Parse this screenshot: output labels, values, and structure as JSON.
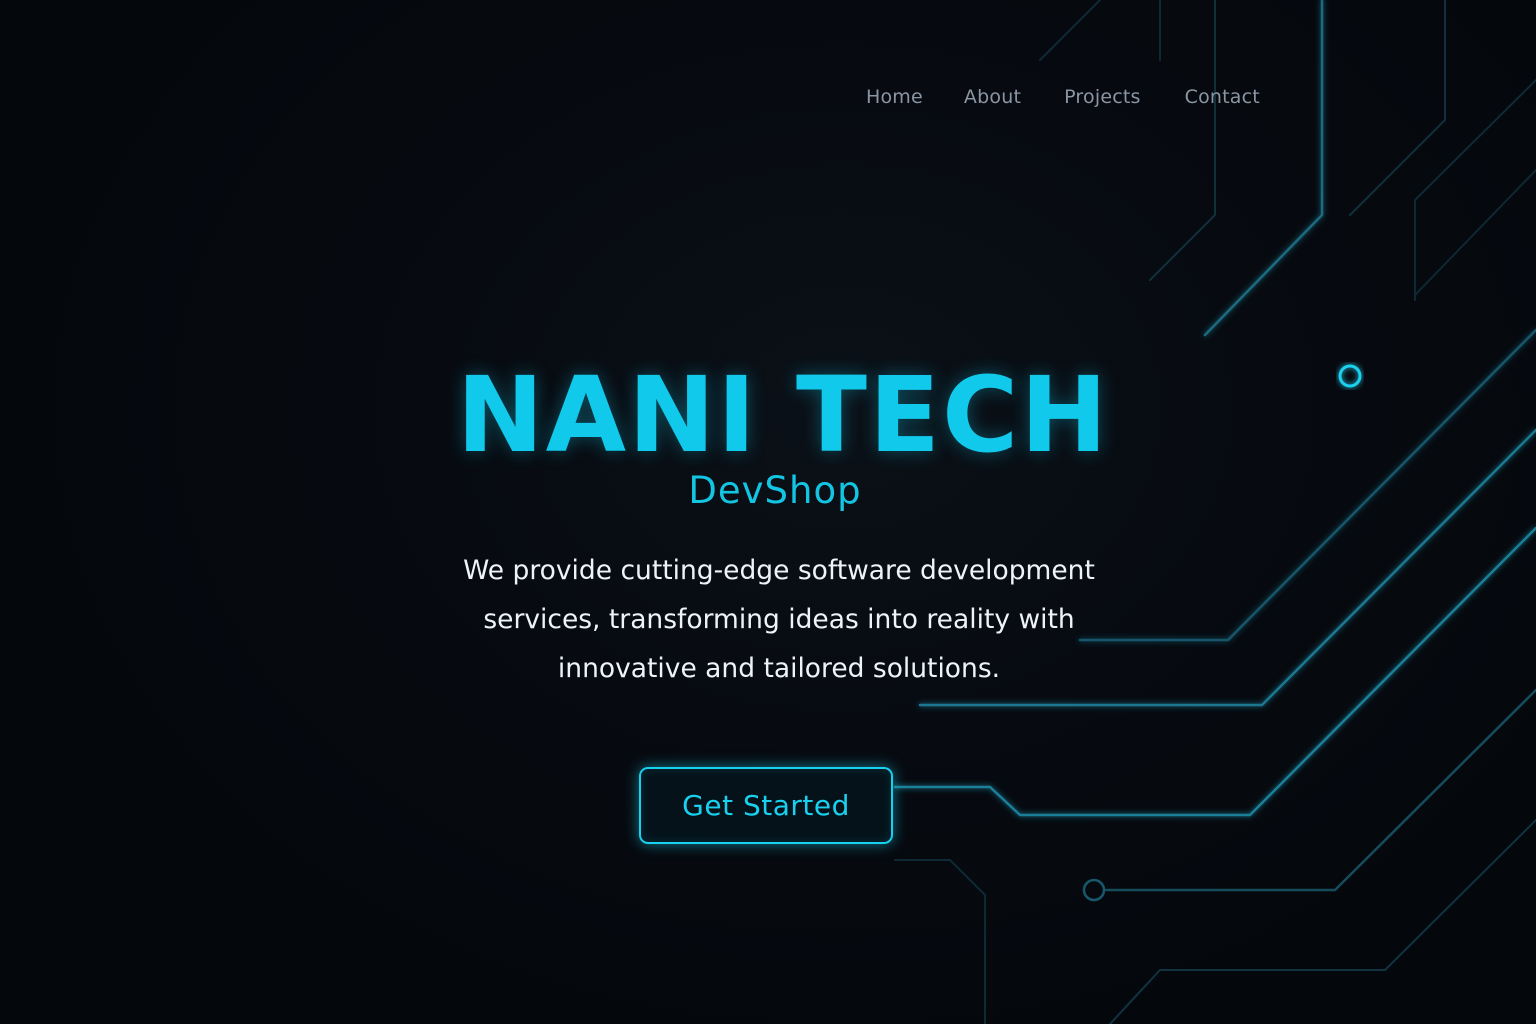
{
  "nav": {
    "items": [
      {
        "label": "Home"
      },
      {
        "label": "About"
      },
      {
        "label": "Projects"
      },
      {
        "label": "Contact"
      }
    ]
  },
  "hero": {
    "title": "NANI TECH",
    "subtitle": "DevShop",
    "description": "We provide cutting-edge software development services, transforming ideas into reality with innovative and tailored solutions.",
    "cta_label": "Get Started"
  },
  "colors": {
    "accent": "#11c9ea",
    "background": "#05080d",
    "nav_text": "#8a96a3",
    "body_text": "#eef3f7"
  },
  "decoration": {
    "background_icon": "circuit-board-lines"
  }
}
